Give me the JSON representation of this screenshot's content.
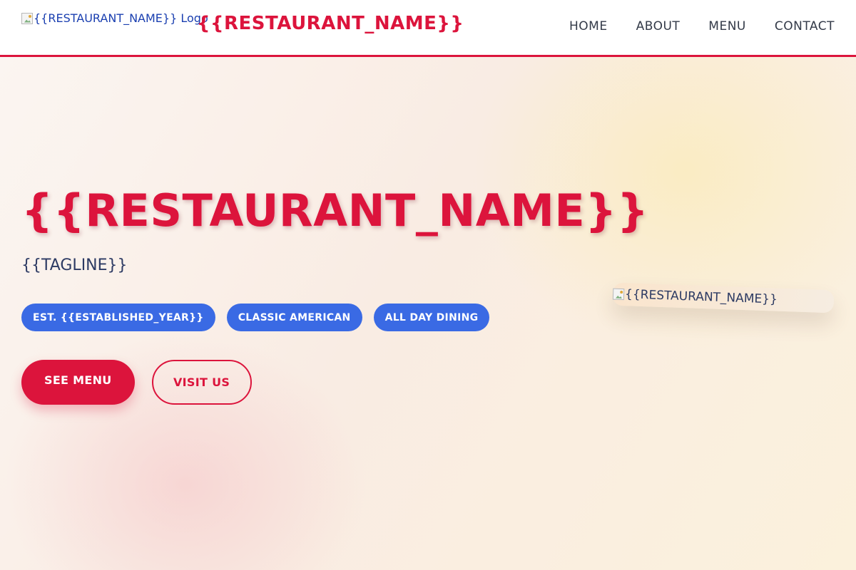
{
  "header": {
    "logo_alt": "{{RESTAURANT_NAME}} Logo",
    "brand": "{{RESTAURANT_NAME}}",
    "nav": [
      {
        "label": "HOME"
      },
      {
        "label": "ABOUT"
      },
      {
        "label": "MENU"
      },
      {
        "label": "CONTACT"
      }
    ]
  },
  "hero": {
    "title": "{{RESTAURANT_NAME}}",
    "tagline": "{{TAGLINE}}",
    "badges": [
      {
        "label": "EST. {{ESTABLISHED_YEAR}}"
      },
      {
        "label": "CLASSIC AMERICAN"
      },
      {
        "label": "ALL DAY DINING"
      }
    ],
    "primary_cta": "SEE MENU",
    "secondary_cta": "VISIT US",
    "image_alt": "{{RESTAURANT_NAME}}"
  },
  "colors": {
    "accent": "#dc143c",
    "badge": "#3a6ae4",
    "nav_text": "#333a48",
    "tagline_text": "#2c3a63"
  },
  "icons": {
    "broken_image": "broken-image-icon"
  }
}
